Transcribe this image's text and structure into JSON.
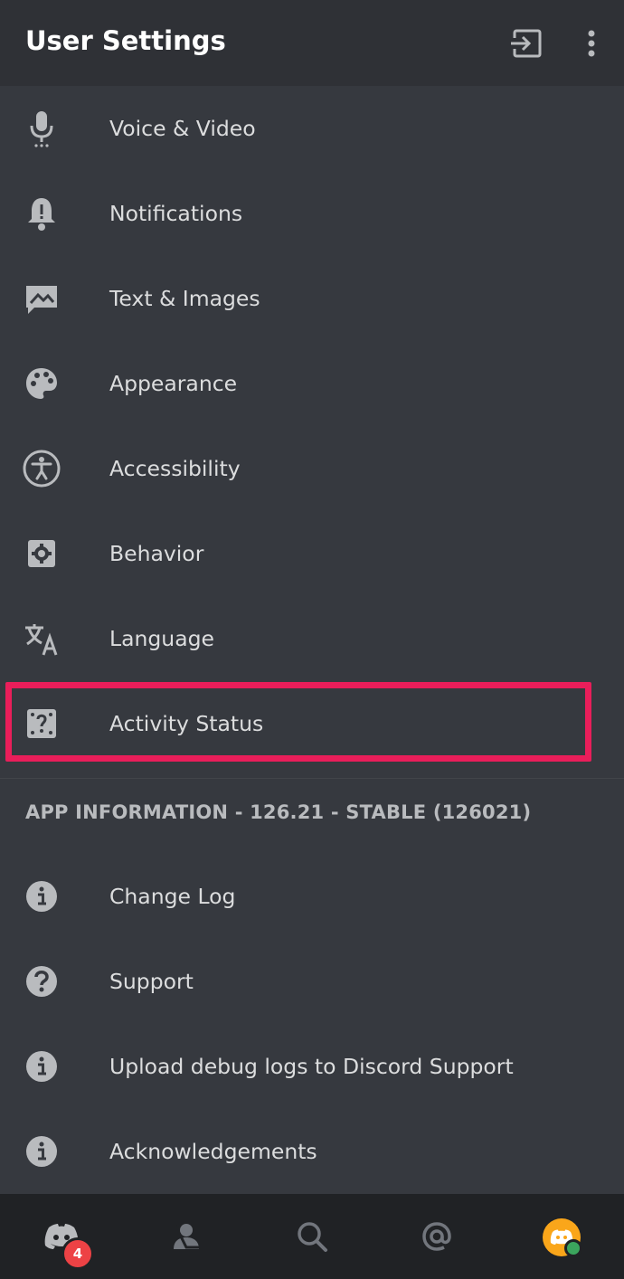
{
  "header": {
    "title": "User Settings",
    "logout_icon": "logout-icon",
    "more_icon": "more-vertical-icon"
  },
  "settings": [
    {
      "label": "Voice & Video",
      "icon": "microphone-icon"
    },
    {
      "label": "Notifications",
      "icon": "bell-icon"
    },
    {
      "label": "Text & Images",
      "icon": "image-icon"
    },
    {
      "label": "Appearance",
      "icon": "palette-icon"
    },
    {
      "label": "Accessibility",
      "icon": "accessibility-icon"
    },
    {
      "label": "Behavior",
      "icon": "gear-icon"
    },
    {
      "label": "Language",
      "icon": "translate-icon"
    },
    {
      "label": "Activity Status",
      "icon": "activity-status-icon",
      "highlighted": true
    }
  ],
  "app_info": {
    "header": "APP INFORMATION - 126.21 - STABLE (126021)",
    "items": [
      {
        "label": "Change Log",
        "icon": "info-icon"
      },
      {
        "label": "Support",
        "icon": "question-icon"
      },
      {
        "label": "Upload debug logs to Discord Support",
        "icon": "info-icon"
      },
      {
        "label": "Acknowledgements",
        "icon": "info-icon"
      }
    ]
  },
  "bottom_nav": {
    "items": [
      {
        "name": "home",
        "icon": "discord-home-icon",
        "badge": "4"
      },
      {
        "name": "friends",
        "icon": "friends-icon"
      },
      {
        "name": "search",
        "icon": "search-icon"
      },
      {
        "name": "mentions",
        "icon": "at-mention-icon"
      },
      {
        "name": "profile",
        "icon": "avatar",
        "status": "online"
      }
    ]
  },
  "colors": {
    "background": "#36393f",
    "header": "#2f3136",
    "bottom_nav": "#202225",
    "highlight": "#e91e5a",
    "badge": "#ed4245",
    "avatar": "#faa61a",
    "online": "#3ba55d"
  }
}
